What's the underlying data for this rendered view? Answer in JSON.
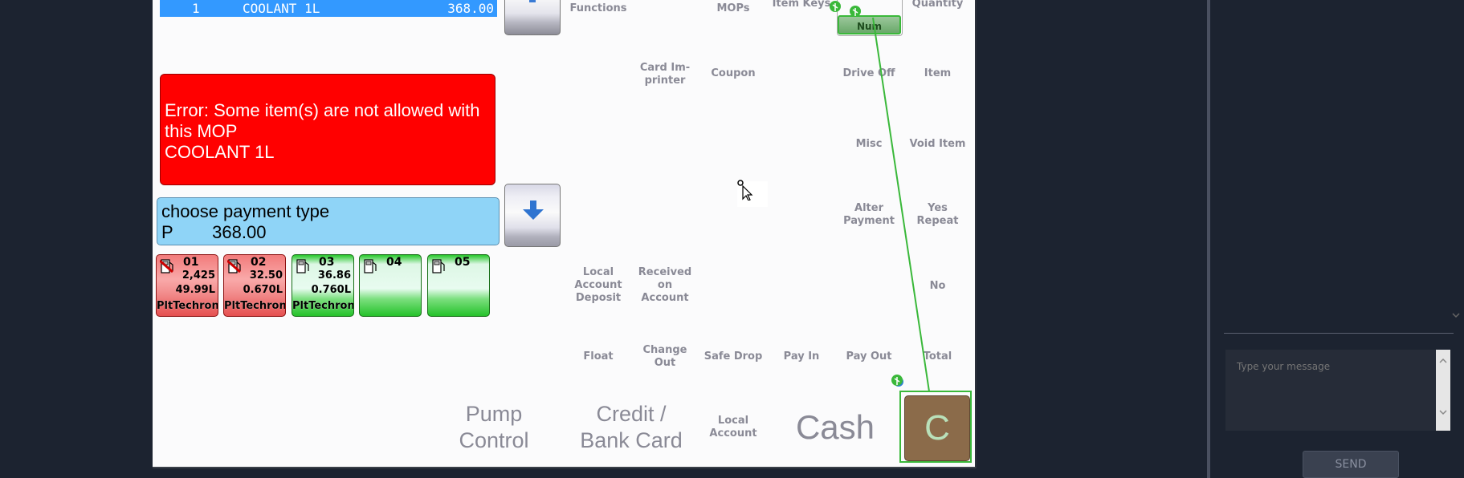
{
  "sale": {
    "qty": "1",
    "item": "COOLANT 1L",
    "amount": "368.00"
  },
  "error_message": "Error: Some item(s) are not allowed with this MOP\nCOOLANT 1L",
  "prompt": {
    "text": "choose payment type",
    "amount_line": "P        368.00"
  },
  "pumps": [
    {
      "number": "01",
      "status": "red",
      "value1": "2,425",
      "value2": "49.99L",
      "grade": "PltTechron"
    },
    {
      "number": "02",
      "status": "red",
      "value1": "32.50",
      "value2": "0.670L",
      "grade": "PltTechron"
    },
    {
      "number": "03",
      "status": "green",
      "value1": "36.86",
      "value2": "0.760L",
      "grade": "PltTechron"
    },
    {
      "number": "04",
      "status": "green",
      "value1": "",
      "value2": "",
      "grade": ""
    },
    {
      "number": "05",
      "status": "green",
      "value1": "",
      "value2": "",
      "grade": ""
    }
  ],
  "keys": {
    "functions": "Functions",
    "mops": "MOPs",
    "item_keys": "Item Keys",
    "quantity": "Quantity",
    "num": "Num",
    "card_imprinter": "Card Im-\nprinter",
    "coupon": "Coupon",
    "drive_off": "Drive Off",
    "item": "Item",
    "misc": "Misc",
    "void_item": "Void Item",
    "alter_payment": "Alter\nPayment",
    "yes_repeat": "Yes\nRepeat",
    "local_account_deposit": "Local\nAccount\nDeposit",
    "received_on_account": "Received\non\nAccount",
    "no": "No",
    "float": "Float",
    "change_out": "Change\nOut",
    "safe_drop": "Safe Drop",
    "pay_in": "Pay In",
    "pay_out": "Pay Out",
    "total": "Total",
    "pump_control": "Pump\nControl",
    "credit_bank_card": "Credit /\nBank Card",
    "local_account": "Local\nAccount",
    "cash": "Cash",
    "clear": "C"
  },
  "chat": {
    "placeholder": "Type your message",
    "send": "SEND"
  },
  "colors": {
    "sale_highlight": "#3399ff",
    "error": "#ff0000",
    "prompt": "#8fd4f7",
    "pump_busy": "#f39090",
    "pump_idle": "#27c72b",
    "clear_key": "#8b6b4a",
    "annotation": "#3ab83a"
  }
}
